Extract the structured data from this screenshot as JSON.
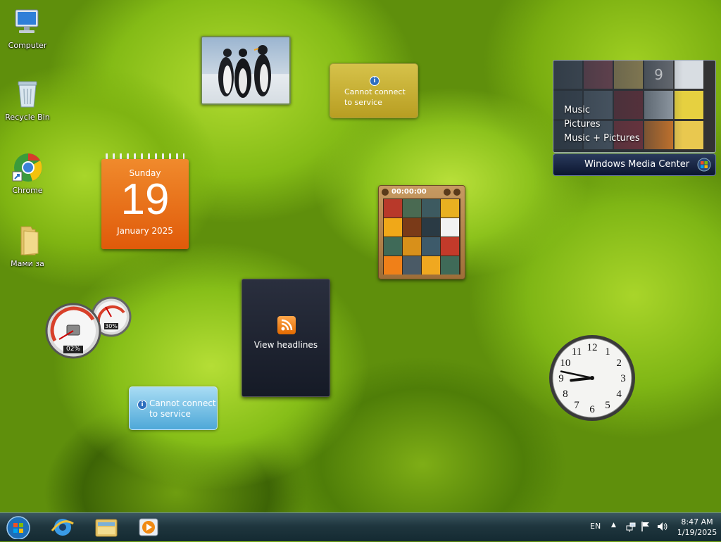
{
  "desktop": {
    "icons": [
      {
        "label": "Computer"
      },
      {
        "label": "Recycle Bin"
      },
      {
        "label": "Chrome"
      },
      {
        "label": "Мами за"
      }
    ]
  },
  "gadgets": {
    "weather_yellow": {
      "message_line1": "Cannot connect",
      "message_line2": "to service"
    },
    "media_center": {
      "menu": [
        "Music",
        "Pictures",
        "Music + Pictures"
      ],
      "brand": "Windows Media Center",
      "tile_number": "9"
    },
    "calendar": {
      "weekday": "Sunday",
      "day": "19",
      "month_year": "January 2025"
    },
    "slide_puzzle": {
      "timer": "00:00:00"
    },
    "feed_headlines": {
      "label": "View headlines"
    },
    "cpu_meter": {
      "cpu": "02%",
      "memory": "30%"
    },
    "weather_blue": {
      "message_line1": "Cannot connect",
      "message_line2": "to service"
    },
    "clock": {
      "numbers": [
        "12",
        "1",
        "2",
        "3",
        "4",
        "5",
        "6",
        "7",
        "8",
        "9",
        "10",
        "11"
      ],
      "hour": 8,
      "minute": 47
    }
  },
  "taskbar": {
    "language": "EN",
    "time": "8:47 AM",
    "date": "1/19/2025"
  }
}
